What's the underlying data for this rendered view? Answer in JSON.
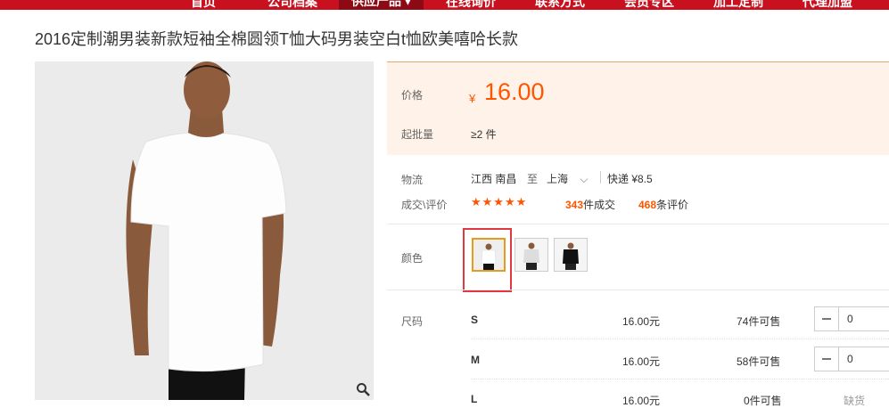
{
  "nav": {
    "items": [
      "首页",
      "公司档案",
      "供应产品",
      "在线询价",
      "联系方式",
      "会员专区",
      "加工定制",
      "代理加盟"
    ],
    "active_index": 2
  },
  "product": {
    "title": "2016定制潮男装新款短袖全棉圆领T恤大码男装空白t恤欧美嘻哈长款"
  },
  "price_panel": {
    "price_label": "价格",
    "currency": "¥",
    "price": "16.00",
    "moq_label": "起批量",
    "moq_value": "≥2 件"
  },
  "logistics": {
    "label": "物流",
    "from": "江西 南昌",
    "to_word": "至",
    "to": "上海",
    "shipping": "快递 ¥8.5"
  },
  "rating": {
    "label": "成交\\评价",
    "stars": "★★★★★",
    "deals_count": "343",
    "deals_suffix": "件成交",
    "reviews_count": "468",
    "reviews_suffix": "条评价"
  },
  "color": {
    "label": "颜色",
    "selected_index": 0
  },
  "sizes": {
    "label": "尺码",
    "rows": [
      {
        "name": "S",
        "price": "16.00元",
        "stock": "74件可售",
        "qty": "0"
      },
      {
        "name": "M",
        "price": "16.00元",
        "stock": "58件可售",
        "qty": "0"
      },
      {
        "name": "L",
        "price": "16.00元",
        "stock": "0件可售",
        "status": "缺货"
      }
    ]
  },
  "colors": {
    "accent": "#ff5500",
    "nav_bg": "#c8101e",
    "price_bg": "#fff2e8",
    "highlight": "#e0383e"
  }
}
